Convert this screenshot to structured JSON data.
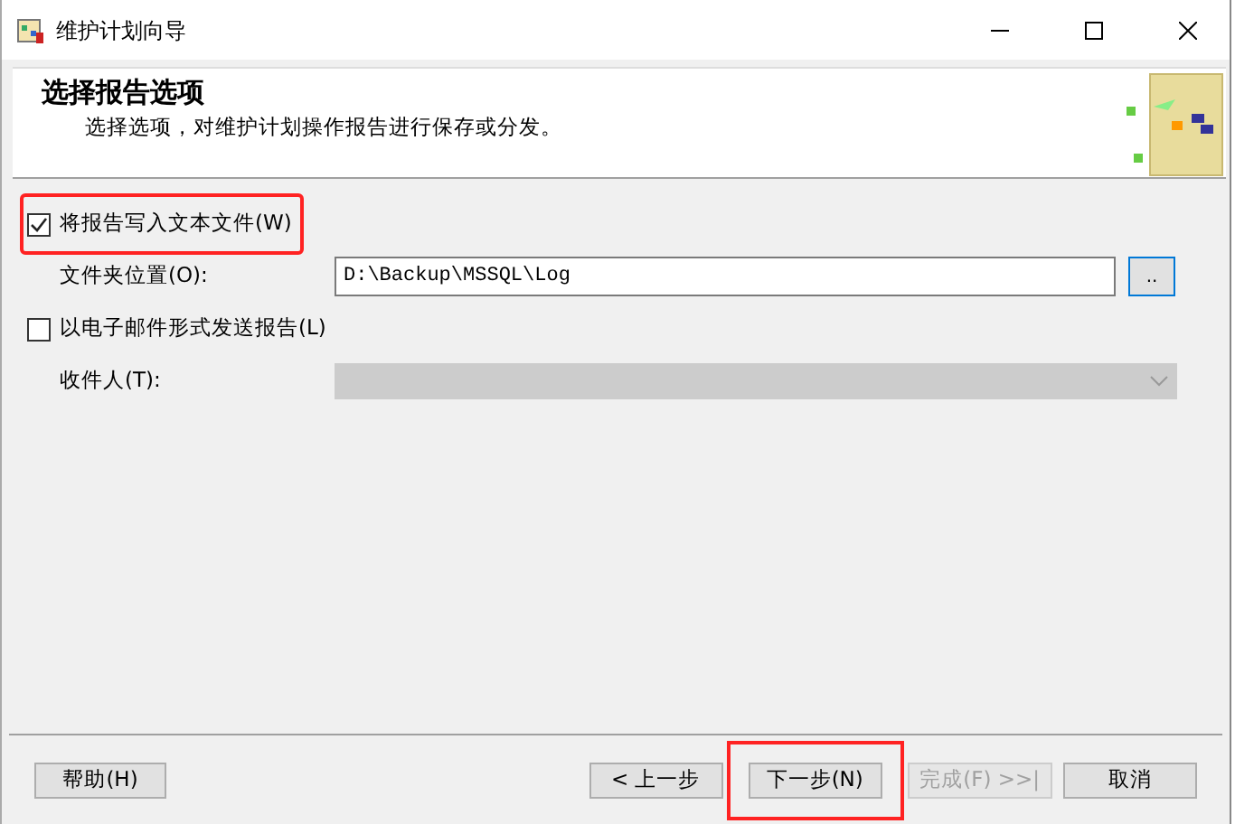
{
  "window": {
    "title": "维护计划向导"
  },
  "header": {
    "title": "选择报告选项",
    "subtitle": "选择选项，对维护计划操作报告进行保存或分发。"
  },
  "options": [
    {
      "kind": "checkbox",
      "label": "将报告写入文本文件(W)",
      "checked": true,
      "highlighted": true
    },
    {
      "kind": "path",
      "label": "文件夹位置(O):",
      "value": "D:\\Backup\\MSSQL\\Log",
      "button": ".."
    },
    {
      "kind": "checkbox",
      "label": "以电子邮件形式发送报告(L)",
      "checked": false,
      "highlighted": false
    },
    {
      "kind": "select",
      "label": "收件人(T):",
      "disabled": true
    }
  ],
  "help_button": {
    "label": "帮助(H)"
  },
  "buttons": [
    {
      "label": "< 上一步",
      "disabled": false,
      "highlighted": false
    },
    {
      "label": "下一步(N)",
      "disabled": false,
      "highlighted": true
    },
    {
      "label": "完成(F) >>|",
      "disabled": true,
      "highlighted": false
    },
    {
      "label": "取消",
      "disabled": false,
      "highlighted": false
    }
  ]
}
